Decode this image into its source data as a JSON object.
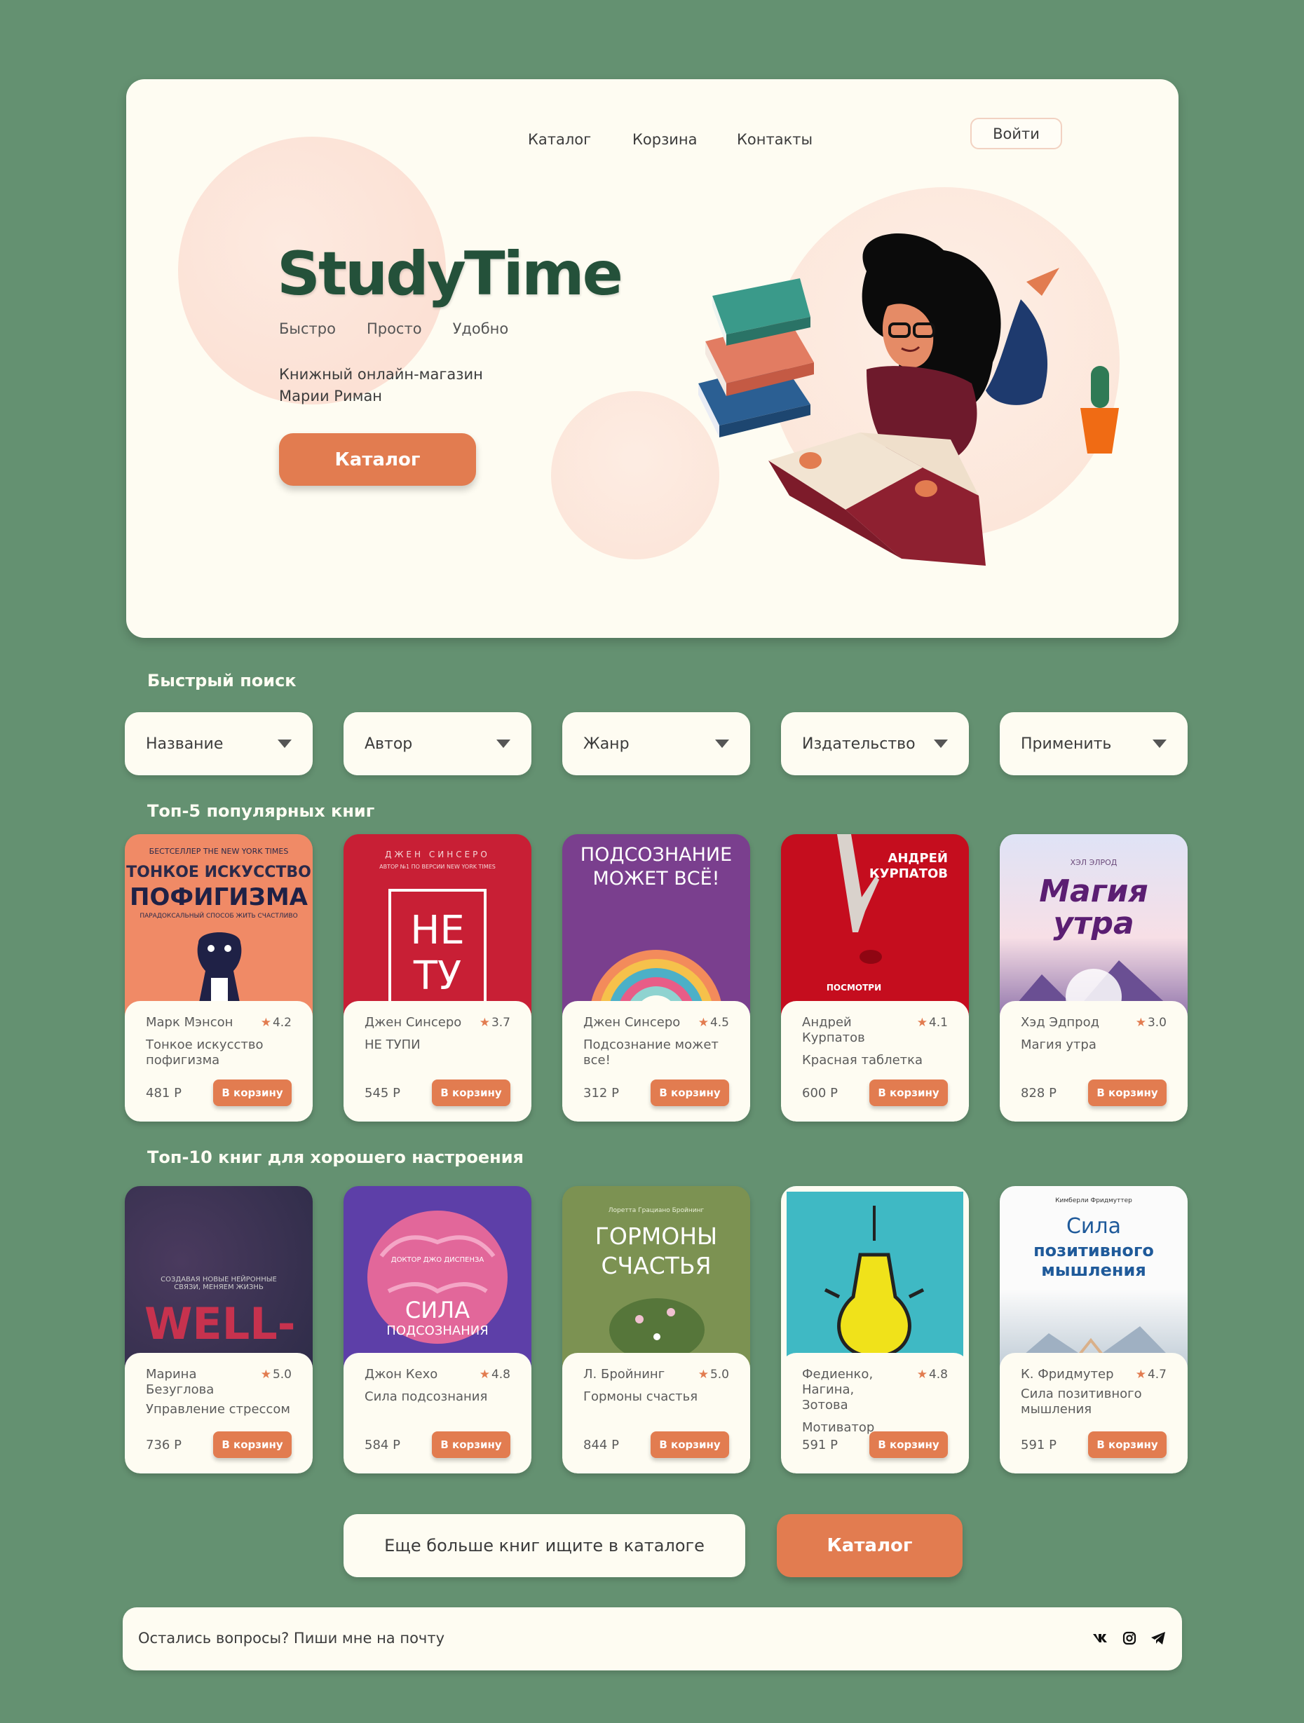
{
  "nav": {
    "links": [
      "Каталог",
      "Корзина",
      "Контакты"
    ],
    "login": "Войти"
  },
  "hero": {
    "brand": "StudyTime",
    "slogans": [
      "Быстро",
      "Просто",
      "Удобно"
    ],
    "desc_line1": "Книжный онлайн-магазин",
    "desc_line2": "Марии Риман",
    "cta": "Каталог"
  },
  "search": {
    "title": "Быстрый поиск",
    "filters": [
      "Название",
      "Автор",
      "Жанр",
      "Издательство",
      "Применить"
    ]
  },
  "top5": {
    "title": "Топ-5 популярных книг",
    "books": [
      {
        "author": "Марк Мэнсон",
        "rating": "4.2",
        "title": "Тонкое искусство пофигизма",
        "price": "481 Р",
        "buy": "В корзину",
        "cover": {
          "top": "БЕСТСЕЛЛЕР THE NEW YORK TIMES",
          "l1": "ТОНКОЕ ИСКУССТВО",
          "l2": "ПОФИГИЗМА",
          "l3": "ПАРАДОКСАЛЬНЫЙ СПОСОБ ЖИТЬ СЧАСТЛИВО"
        }
      },
      {
        "author": "Джен Синсеро",
        "rating": "3.7",
        "title": "НЕ ТУПИ",
        "price": "545 Р",
        "buy": "В корзину",
        "cover": {
          "top": "ДЖЕН СИНСЕРО",
          "sub": "АВТОР №1 ПО ВЕРСИИ NEW YORK TIMES",
          "l1": "НЕ",
          "l2": "ТУ"
        }
      },
      {
        "author": "Джен Синсеро",
        "rating": "4.5",
        "title": "Подсознание может все!",
        "price": "312 Р",
        "buy": "В корзину",
        "cover": {
          "l1": "ПОДСОЗНАНИЕ",
          "l2": "МОЖЕТ ВСЁ!"
        }
      },
      {
        "author": "Андрей Курпатов",
        "rating": "4.1",
        "title": "Красная таблетка",
        "price": "600 Р",
        "buy": "В корзину",
        "cover": {
          "l1": "АНДРЕЙ",
          "l2": "КУРПАТОВ",
          "l3": "ПОСМОТРИ"
        }
      },
      {
        "author": "Хэд Эдпрод",
        "rating": "3.0",
        "title": "Магия утра",
        "price": "828 Р",
        "buy": "В корзину",
        "cover": {
          "top": "ХЭЛ ЭЛРОД",
          "l1": "Магия",
          "l2": "утра"
        }
      }
    ]
  },
  "top10": {
    "title": "Топ-10 книг для хорошего настроения",
    "books": [
      {
        "author": "Марина Безуглова",
        "rating": "5.0",
        "title": "Управление стрессом",
        "price": "736 Р",
        "buy": "В корзину",
        "cover": {
          "sub": "СОЗДАВАЯ НОВЫЕ НЕЙРОННЫЕ СВЯЗИ, МЕНЯЕМ ЖИЗНЬ",
          "l1": "WELL-"
        }
      },
      {
        "author": "Джон Кехо",
        "rating": "4.8",
        "title": "Сила подсознания",
        "price": "584 Р",
        "buy": "В корзину",
        "cover": {
          "top": "ДОКТОР ДЖО ДИСПЕНЗА",
          "l1": "СИЛА",
          "l2": "ПОДСОЗНАНИЯ"
        }
      },
      {
        "author": "Л. Бройнинг",
        "rating": "5.0",
        "title": "Гормоны счастья",
        "price": "844 Р",
        "buy": "В корзину",
        "cover": {
          "top": "Лоретта Грациано Бройнинг",
          "l1": "ГОРМОНЫ",
          "l2": "СЧАСТЬЯ"
        }
      },
      {
        "author": "Федиенко, Нагина, Зотова",
        "rating": "4.8",
        "title": "Мотиватор",
        "price": "591 Р",
        "buy": "В корзину",
        "cover": {}
      },
      {
        "author": "К. Фридмутер",
        "rating": "4.7",
        "title": "Сила позитивного мышления",
        "price": "591 Р",
        "buy": "В корзину",
        "cover": {
          "top": "Кимберли Фридмуттер",
          "l1": "Сила",
          "l2": "позитивного",
          "l3": "мышления"
        }
      }
    ]
  },
  "more": {
    "text": "Еще больше книг ищите в каталоге",
    "cta": "Каталог"
  },
  "footer": {
    "text": "Остались вопросы? Пиши мне на почту",
    "social": [
      "vk-icon",
      "instagram-icon",
      "telegram-icon"
    ]
  },
  "colors": {
    "accent": "#e27c50",
    "bg": "#649171",
    "panel": "#fefcf2",
    "brand": "#24513a"
  }
}
